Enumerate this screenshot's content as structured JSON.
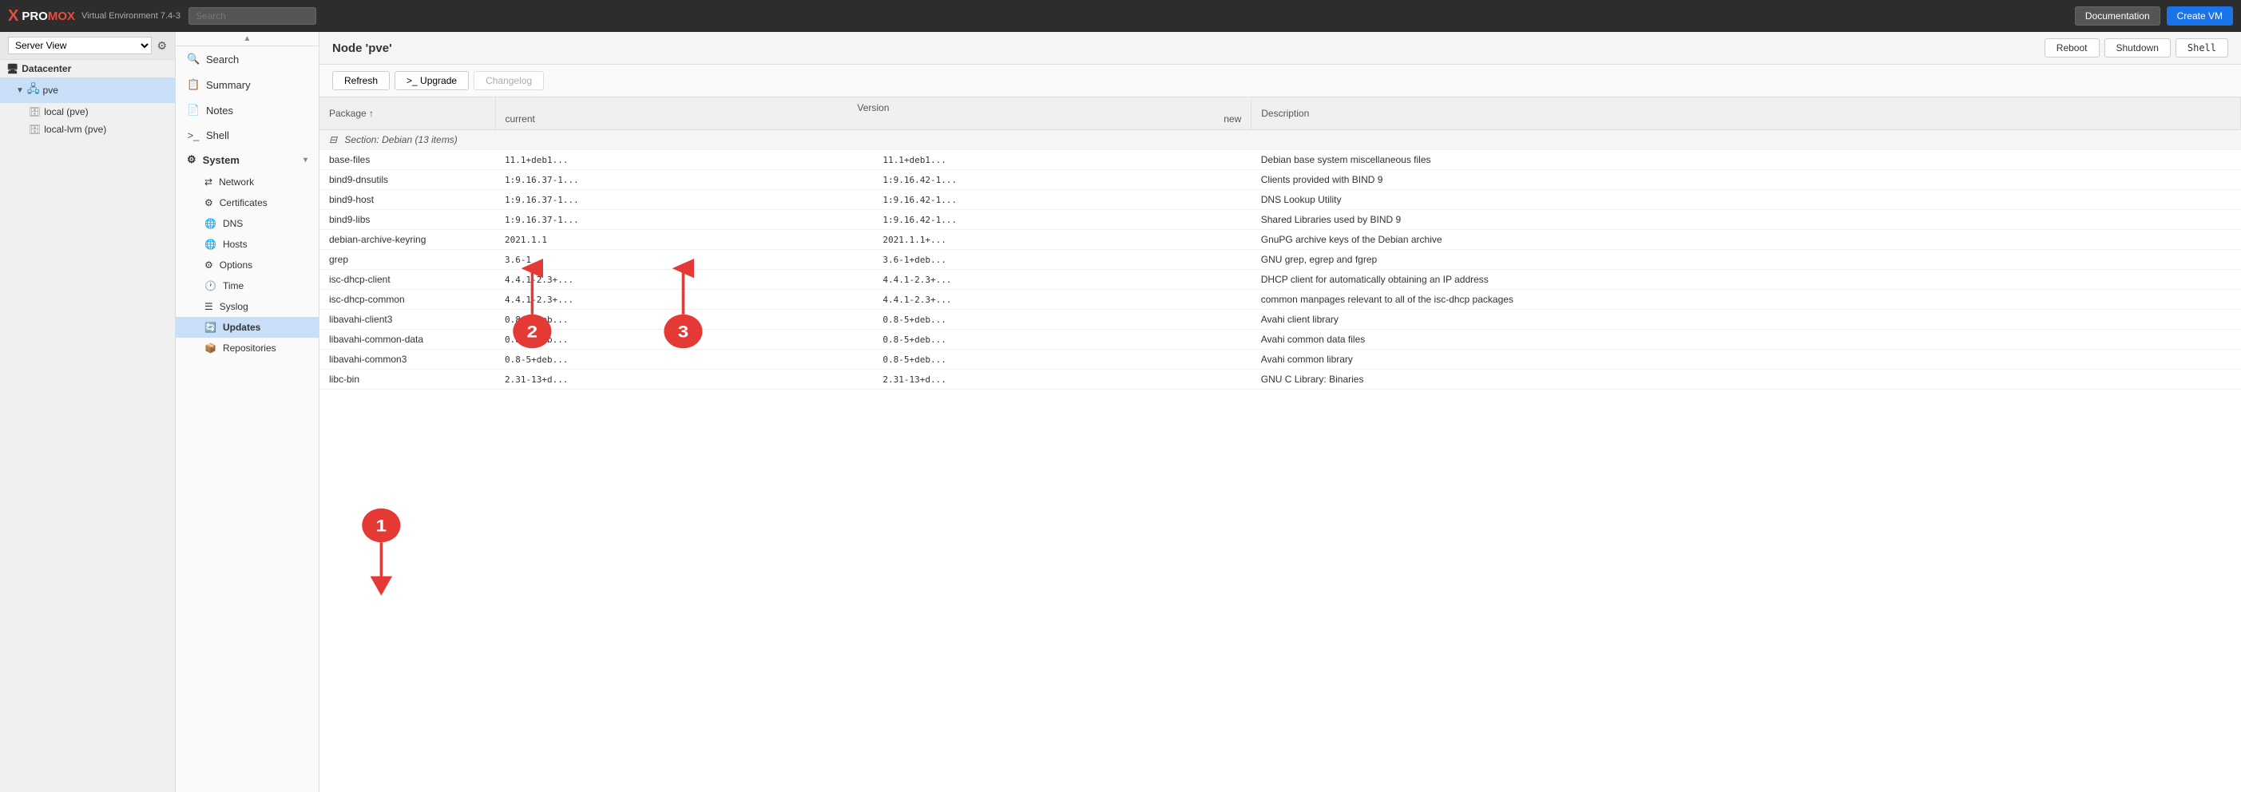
{
  "topbar": {
    "logo_x": "X",
    "logo_pro": "PRO",
    "logo_mox": "MOX",
    "logo_version": "Virtual Environment 7.4-3",
    "search_placeholder": "Search",
    "doc_btn": "Documentation",
    "create_btn": "Create VM"
  },
  "sidebar_header": {
    "view_label": "Server View"
  },
  "tree": {
    "datacenter": "Datacenter",
    "pve": "pve",
    "storage1": "local (pve)",
    "storage2": "local-lvm (pve)"
  },
  "nav": {
    "scroll_up": "▲",
    "items": [
      {
        "id": "search",
        "icon": "🔍",
        "label": "Search"
      },
      {
        "id": "summary",
        "icon": "📋",
        "label": "Summary"
      },
      {
        "id": "notes",
        "icon": "📄",
        "label": "Notes"
      },
      {
        "id": "shell",
        "icon": ">_",
        "label": "Shell"
      }
    ],
    "system_label": "System",
    "system_items": [
      {
        "id": "network",
        "icon": "⇄",
        "label": "Network"
      },
      {
        "id": "certificates",
        "icon": "⚙",
        "label": "Certificates"
      },
      {
        "id": "dns",
        "icon": "🌐",
        "label": "DNS"
      },
      {
        "id": "hosts",
        "icon": "🌐",
        "label": "Hosts"
      },
      {
        "id": "options",
        "icon": "⚙",
        "label": "Options"
      },
      {
        "id": "time",
        "icon": "🕐",
        "label": "Time"
      },
      {
        "id": "syslog",
        "icon": "☰",
        "label": "Syslog"
      },
      {
        "id": "updates",
        "icon": "🔄",
        "label": "Updates",
        "active": true
      },
      {
        "id": "repositories",
        "icon": "📦",
        "label": "Repositories"
      }
    ]
  },
  "content": {
    "title": "Node 'pve'",
    "reboot_btn": "Reboot",
    "shutdown_btn": "Shutdown",
    "shell_btn": "Shell"
  },
  "toolbar": {
    "refresh_btn": "Refresh",
    "upgrade_btn": ">_  Upgrade",
    "changelog_btn": "Changelog"
  },
  "table": {
    "col_package": "Package",
    "col_version": "Version",
    "col_current": "current",
    "col_new": "new",
    "col_description": "Description",
    "section_label": "Section: Debian (13 items)",
    "rows": [
      {
        "package": "base-files",
        "current": "11.1+deb1...",
        "new": "11.1+deb1...",
        "description": "Debian base system miscellaneous files"
      },
      {
        "package": "bind9-dnsutils",
        "current": "1:9.16.37-1...",
        "new": "1:9.16.42-1...",
        "description": "Clients provided with BIND 9"
      },
      {
        "package": "bind9-host",
        "current": "1:9.16.37-1...",
        "new": "1:9.16.42-1...",
        "description": "DNS Lookup Utility"
      },
      {
        "package": "bind9-libs",
        "current": "1:9.16.37-1...",
        "new": "1:9.16.42-1...",
        "description": "Shared Libraries used by BIND 9"
      },
      {
        "package": "debian-archive-keyring",
        "current": "2021.1.1",
        "new": "2021.1.1+...",
        "description": "GnuPG archive keys of the Debian archive"
      },
      {
        "package": "grep",
        "current": "3.6-1",
        "new": "3.6-1+deb...",
        "description": "GNU grep, egrep and fgrep"
      },
      {
        "package": "isc-dhcp-client",
        "current": "4.4.1-2.3+...",
        "new": "4.4.1-2.3+...",
        "description": "DHCP client for automatically obtaining an IP address"
      },
      {
        "package": "isc-dhcp-common",
        "current": "4.4.1-2.3+...",
        "new": "4.4.1-2.3+...",
        "description": "common manpages relevant to all of the isc-dhcp packages"
      },
      {
        "package": "libavahi-client3",
        "current": "0.8-5+deb...",
        "new": "0.8-5+deb...",
        "description": "Avahi client library"
      },
      {
        "package": "libavahi-common-data",
        "current": "0.8-5+deb...",
        "new": "0.8-5+deb...",
        "description": "Avahi common data files"
      },
      {
        "package": "libavahi-common3",
        "current": "0.8-5+deb...",
        "new": "0.8-5+deb...",
        "description": "Avahi common library"
      },
      {
        "package": "libc-bin",
        "current": "2.31-13+d...",
        "new": "2.31-13+d...",
        "description": "GNU C Library: Binaries"
      }
    ]
  },
  "annotations": {
    "badge1": "1",
    "badge2": "2",
    "badge3": "3"
  },
  "colors": {
    "badge_bg": "#e53935",
    "badge_text": "#ffffff",
    "active_nav": "#c8dff7",
    "selected_tree": "#c8dff7",
    "header_bg": "#2d2d2d"
  }
}
